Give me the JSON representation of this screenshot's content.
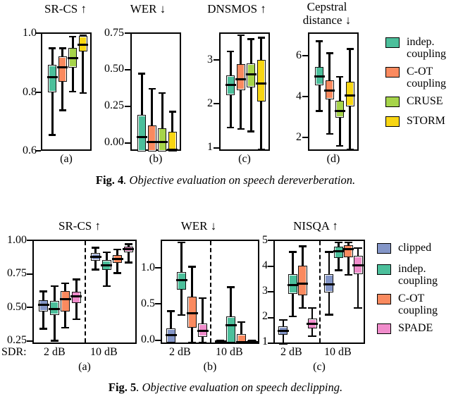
{
  "figures": [
    {
      "id": "fig4",
      "caption_prefix": "Fig. 4",
      "caption_text": ". Objective evaluation on speech dereverberation.",
      "legend": [
        {
          "label": "indep.\ncoupling",
          "color": "#4bbf9a"
        },
        {
          "label": "C-OT\ncoupling",
          "color": "#fa8a5f"
        },
        {
          "label": "CRUSE",
          "color": "#a3d martial"
        },
        {
          "label": "STORM",
          "color": "#f7d518"
        }
      ]
    }
  ],
  "fig4": {
    "caption_prefix": "Fig. 4",
    "caption_text": ". Objective evaluation on speech dereverberation.",
    "titles": {
      "a": "SR-CS ↑",
      "b": "WER ↓",
      "c": "DNSMOS ↑",
      "d": "Cepstral\ndistance ↓"
    },
    "sublabels": {
      "a": "(a)",
      "b": "(b)",
      "c": "(c)",
      "d": "(d)"
    },
    "legend": [
      {
        "label": "indep.\ncoupling",
        "color": "#4cbf9b"
      },
      {
        "label": "C-OT\ncoupling",
        "color": "#fa8a5f"
      },
      {
        "label": "CRUSE",
        "color": "#a6d44a"
      },
      {
        "label": "STORM",
        "color": "#f8d613"
      }
    ],
    "yticks": {
      "a": [
        "1.0",
        "0.8",
        "0.6"
      ],
      "b": [
        "0.75",
        "0.50",
        "0.25",
        "0.00"
      ],
      "c": [
        "3",
        "2",
        "1"
      ],
      "d": [
        "6",
        "4",
        "2"
      ]
    }
  },
  "fig5": {
    "caption_prefix": "Fig. 5",
    "caption_text": ". Objective evaluation on speech declipping.",
    "titles": {
      "a": "SR-CS ↑",
      "b": "WER ↓",
      "c": "NISQA ↑"
    },
    "sublabels": {
      "a": "(a)",
      "b": "(b)",
      "c": "(c)"
    },
    "sdr_label": "SDR:",
    "group_labels": [
      "2 dB",
      "10 dB"
    ],
    "legend": [
      {
        "label": "clipped",
        "color": "#8496c8"
      },
      {
        "label": "indep.\ncoupling",
        "color": "#4cbf9b"
      },
      {
        "label": "C-OT\ncoupling",
        "color": "#fa8a5f"
      },
      {
        "label": "SPADE",
        "color": "#f08ccb"
      }
    ],
    "yticks": {
      "a": [
        "1.00",
        "0.75",
        "0.50",
        "0.25"
      ],
      "b": [
        "1.0",
        "0.5",
        "0.0"
      ],
      "c": [
        "5",
        "4",
        "3",
        "2",
        "1"
      ]
    }
  },
  "chart_data": [
    {
      "type": "box",
      "figure": "Fig. 4",
      "panel": "(a)",
      "title": "SR-CS ↑",
      "ylabel": "",
      "ylim": [
        0.6,
        1.0
      ],
      "yticks": [
        1.0,
        0.8,
        0.6
      ],
      "categories": [
        "indep. coupling",
        "C-OT coupling",
        "CRUSE",
        "STORM"
      ],
      "boxes": [
        {
          "name": "indep. coupling",
          "color": "#4cbf9b",
          "whisker_low": 0.655,
          "q1": 0.805,
          "median": 0.855,
          "q3": 0.895,
          "whisker_high": 0.955
        },
        {
          "name": "C-OT coupling",
          "color": "#fa8a5f",
          "whisker_low": 0.74,
          "q1": 0.84,
          "median": 0.888,
          "q3": 0.925,
          "whisker_high": 0.955
        },
        {
          "name": "CRUSE",
          "color": "#a6d44a",
          "whisker_low": 0.805,
          "q1": 0.89,
          "median": 0.92,
          "q3": 0.955,
          "whisker_high": 0.995
        },
        {
          "name": "STORM",
          "color": "#f8d613",
          "whisker_low": 0.8,
          "q1": 0.945,
          "median": 0.968,
          "q3": 0.995,
          "whisker_high": 1.0
        }
      ]
    },
    {
      "type": "box",
      "figure": "Fig. 4",
      "panel": "(b)",
      "title": "WER ↓",
      "ylim": [
        0.0,
        0.8
      ],
      "yticks": [
        0.75,
        0.5,
        0.25,
        0.0
      ],
      "categories": [
        "indep. coupling",
        "C-OT coupling",
        "CRUSE",
        "STORM"
      ],
      "boxes": [
        {
          "name": "indep. coupling",
          "color": "#4cbf9b",
          "whisker_low": 0.0,
          "q1": 0.0,
          "median": 0.095,
          "q3": 0.245,
          "whisker_high": 0.535
        },
        {
          "name": "C-OT coupling",
          "color": "#fa8a5f",
          "whisker_low": 0.0,
          "q1": 0.0,
          "median": 0.06,
          "q3": 0.175,
          "whisker_high": 0.43
        },
        {
          "name": "CRUSE",
          "color": "#a6d44a",
          "whisker_low": 0.0,
          "q1": 0.0,
          "median": 0.06,
          "q3": 0.155,
          "whisker_high": 0.4
        },
        {
          "name": "STORM",
          "color": "#f8d613",
          "whisker_low": 0.0,
          "q1": 0.0,
          "median": 0.005,
          "q3": 0.13,
          "whisker_high": 0.27
        }
      ]
    },
    {
      "type": "box",
      "figure": "Fig. 4",
      "panel": "(c)",
      "title": "DNSMOS ↑",
      "ylim": [
        1.0,
        3.5
      ],
      "yticks": [
        3,
        2,
        1
      ],
      "categories": [
        "indep. coupling",
        "C-OT coupling",
        "CRUSE",
        "STORM"
      ],
      "boxes": [
        {
          "name": "indep. coupling",
          "color": "#4cbf9b",
          "whisker_low": 1.5,
          "q1": 2.22,
          "median": 2.42,
          "q3": 2.62,
          "whisker_high": 3.15
        },
        {
          "name": "C-OT coupling",
          "color": "#fa8a5f",
          "whisker_low": 1.47,
          "q1": 2.32,
          "median": 2.55,
          "q3": 2.87,
          "whisker_high": 3.5
        },
        {
          "name": "CRUSE",
          "color": "#a6d44a",
          "whisker_low": 1.42,
          "q1": 2.38,
          "median": 2.65,
          "q3": 2.88,
          "whisker_high": 3.42
        },
        {
          "name": "STORM",
          "color": "#f8d613",
          "whisker_low": 1.03,
          "q1": 2.07,
          "median": 2.45,
          "q3": 2.96,
          "whisker_high": 3.45
        }
      ]
    },
    {
      "type": "box",
      "figure": "Fig. 4",
      "panel": "(d)",
      "title": "Cepstral distance ↓",
      "ylim": [
        1.1,
        6.9
      ],
      "yticks": [
        6,
        4,
        2
      ],
      "categories": [
        "indep. coupling",
        "C-OT coupling",
        "CRUSE",
        "STORM"
      ],
      "boxes": [
        {
          "name": "indep. coupling",
          "color": "#4cbf9b",
          "whisker_low": 3.1,
          "q1": 4.42,
          "median": 4.82,
          "q3": 5.3,
          "whisker_high": 6.6
        },
        {
          "name": "C-OT coupling",
          "color": "#fa8a5f",
          "whisker_low": 1.95,
          "q1": 3.72,
          "median": 4.12,
          "q3": 4.62,
          "whisker_high": 6.0
        },
        {
          "name": "CRUSE",
          "color": "#a6d44a",
          "whisker_low": 1.35,
          "q1": 2.78,
          "median": 3.1,
          "q3": 3.6,
          "whisker_high": 4.82
        },
        {
          "name": "STORM",
          "color": "#f8d613",
          "whisker_low": 1.15,
          "q1": 3.35,
          "median": 3.88,
          "q3": 4.55,
          "whisker_high": 6.2
        }
      ]
    },
    {
      "type": "box",
      "figure": "Fig. 5",
      "panel": "(a)",
      "title": "SR-CS ↑",
      "ylim": [
        0.22,
        1.0
      ],
      "yticks": [
        1.0,
        0.75,
        0.5,
        0.25
      ],
      "groups": [
        "2 dB",
        "10 dB"
      ],
      "categories": [
        "clipped",
        "indep. coupling",
        "C-OT coupling",
        "SPADE"
      ],
      "boxes": [
        {
          "group": "2 dB",
          "name": "clipped",
          "color": "#8496c8",
          "whisker_low": 0.335,
          "q1": 0.475,
          "median": 0.52,
          "q3": 0.555,
          "whisker_high": 0.625
        },
        {
          "group": "2 dB",
          "name": "indep. coupling",
          "color": "#4cbf9b",
          "whisker_low": 0.245,
          "q1": 0.445,
          "median": 0.49,
          "q3": 0.545,
          "whisker_high": 0.665
        },
        {
          "group": "2 dB",
          "name": "C-OT coupling",
          "color": "#fa8a5f",
          "whisker_low": 0.345,
          "q1": 0.47,
          "median": 0.565,
          "q3": 0.625,
          "whisker_high": 0.685
        },
        {
          "group": "2 dB",
          "name": "SPADE",
          "color": "#f08ccb",
          "whisker_low": 0.41,
          "q1": 0.535,
          "median": 0.585,
          "q3": 0.62,
          "whisker_high": 0.715
        },
        {
          "group": "10 dB",
          "name": "clipped",
          "color": "#8496c8",
          "whisker_low": 0.79,
          "q1": 0.865,
          "median": 0.888,
          "q3": 0.915,
          "whisker_high": 0.96
        },
        {
          "group": "10 dB",
          "name": "indep. coupling",
          "color": "#4cbf9b",
          "whisker_low": 0.665,
          "q1": 0.79,
          "median": 0.825,
          "q3": 0.86,
          "whisker_high": 0.925
        },
        {
          "group": "10 dB",
          "name": "C-OT coupling",
          "color": "#fa8a5f",
          "whisker_low": 0.765,
          "q1": 0.845,
          "median": 0.875,
          "q3": 0.9,
          "whisker_high": 0.945
        },
        {
          "group": "10 dB",
          "name": "SPADE",
          "color": "#f08ccb",
          "whisker_low": 0.845,
          "q1": 0.93,
          "median": 0.948,
          "q3": 0.965,
          "whisker_high": 0.985
        }
      ]
    },
    {
      "type": "box",
      "figure": "Fig. 5",
      "panel": "(b)",
      "title": "WER ↓",
      "ylim": [
        -0.02,
        1.32
      ],
      "yticks": [
        1.0,
        0.5,
        0.0
      ],
      "groups": [
        "2 dB",
        "10 dB"
      ],
      "categories": [
        "clipped",
        "indep. coupling",
        "C-OT coupling",
        "SPADE"
      ],
      "boxes": [
        {
          "group": "2 dB",
          "name": "clipped",
          "color": "#8496c8",
          "whisker_low": 0.0,
          "q1": 0.0,
          "median": 0.1,
          "q3": 0.175,
          "whisker_high": 0.41
        },
        {
          "group": "2 dB",
          "name": "indep. coupling",
          "color": "#4cbf9b",
          "whisker_low": 0.36,
          "q1": 0.7,
          "median": 0.82,
          "q3": 0.92,
          "whisker_high": 1.32
        },
        {
          "group": "2 dB",
          "name": "C-OT coupling",
          "color": "#fa8a5f",
          "whisker_low": 0.0,
          "q1": 0.195,
          "median": 0.385,
          "q3": 0.6,
          "whisker_high": 1.0
        },
        {
          "group": "2 dB",
          "name": "SPADE",
          "color": "#f08ccb",
          "whisker_low": 0.0,
          "q1": 0.08,
          "median": 0.155,
          "q3": 0.245,
          "whisker_high": 0.585
        },
        {
          "group": "10 dB",
          "name": "clipped",
          "color": "#8496c8",
          "whisker_low": 0.0,
          "q1": 0.0,
          "median": 0.012,
          "q3": 0.022,
          "whisker_high": 0.025
        },
        {
          "group": "10 dB",
          "name": "indep. coupling",
          "color": "#4cbf9b",
          "whisker_low": 0.0,
          "q1": 0.0,
          "median": 0.225,
          "q3": 0.335,
          "whisker_high": 0.73
        },
        {
          "group": "10 dB",
          "name": "C-OT coupling",
          "color": "#fa8a5f",
          "whisker_low": 0.0,
          "q1": 0.0,
          "median": 0.0,
          "q3": 0.105,
          "whisker_high": 0.27
        },
        {
          "group": "10 dB",
          "name": "SPADE",
          "color": "#f08ccb",
          "whisker_low": 0.0,
          "q1": 0.0,
          "median": 0.0,
          "q3": 0.02,
          "whisker_high": 0.025
        }
      ]
    },
    {
      "type": "box",
      "figure": "Fig. 5",
      "panel": "(c)",
      "title": "NISQA ↑",
      "ylim": [
        1.0,
        5.0
      ],
      "yticks": [
        5,
        4,
        3,
        2,
        1
      ],
      "groups": [
        "2 dB",
        "10 dB"
      ],
      "categories": [
        "clipped",
        "indep. coupling",
        "C-OT coupling",
        "SPADE"
      ],
      "boxes": [
        {
          "group": "2 dB",
          "name": "clipped",
          "color": "#8496c8",
          "whisker_low": 1.0,
          "q1": 1.37,
          "median": 1.52,
          "q3": 1.68,
          "whisker_high": 1.95
        },
        {
          "group": "2 dB",
          "name": "indep. coupling",
          "color": "#4cbf9b",
          "whisker_low": 2.08,
          "q1": 3.0,
          "median": 3.33,
          "q3": 3.72,
          "whisker_high": 4.62
        },
        {
          "group": "2 dB",
          "name": "C-OT coupling",
          "color": "#fa8a5f",
          "whisker_low": 2.42,
          "q1": 2.92,
          "median": 3.38,
          "q3": 4.08,
          "whisker_high": 4.85
        },
        {
          "group": "2 dB",
          "name": "SPADE",
          "color": "#f08ccb",
          "whisker_low": 1.3,
          "q1": 1.62,
          "median": 1.8,
          "q3": 1.98,
          "whisker_high": 2.42
        },
        {
          "group": "10 dB",
          "name": "clipped",
          "color": "#8496c8",
          "whisker_low": 2.15,
          "q1": 3.05,
          "median": 3.35,
          "q3": 3.72,
          "whisker_high": 4.62
        },
        {
          "group": "10 dB",
          "name": "indep. coupling",
          "color": "#4cbf9b",
          "whisker_low": 3.9,
          "q1": 4.4,
          "median": 4.65,
          "q3": 4.82,
          "whisker_high": 5.0
        },
        {
          "group": "10 dB",
          "name": "C-OT coupling",
          "color": "#fa8a5f",
          "whisker_low": 3.72,
          "q1": 4.42,
          "median": 4.75,
          "q3": 4.88,
          "whisker_high": 5.0
        },
        {
          "group": "10 dB",
          "name": "SPADE",
          "color": "#f08ccb",
          "whisker_low": 2.42,
          "q1": 3.78,
          "median": 4.1,
          "q3": 4.45,
          "whisker_high": 4.78
        }
      ]
    }
  ]
}
